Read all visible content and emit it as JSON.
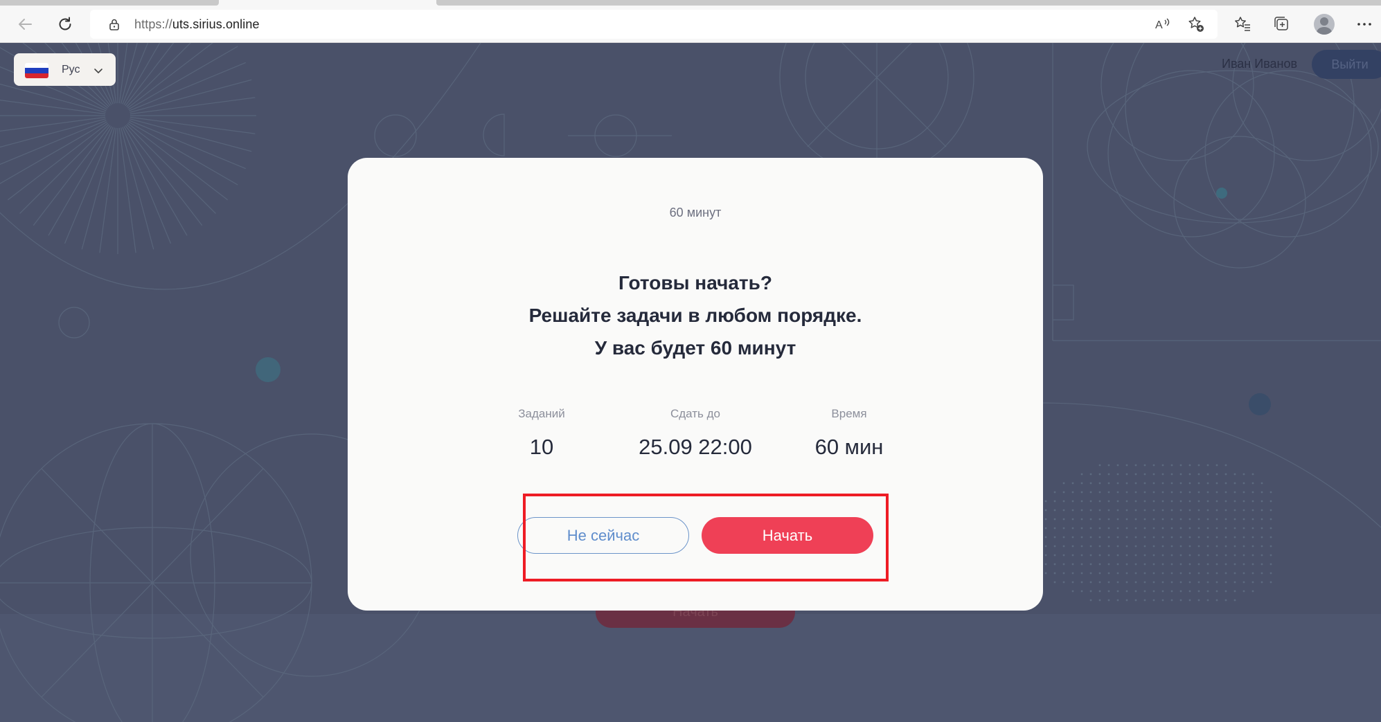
{
  "browser": {
    "url_scheme": "https://",
    "url_host": "uts.sirius.online",
    "icons": [
      "back-arrow-icon",
      "refresh-icon",
      "lock-icon",
      "read-aloud-icon",
      "add-favorite-icon",
      "favorites-icon",
      "collections-icon",
      "profile-avatar",
      "more-icon"
    ]
  },
  "page": {
    "language": {
      "label": "Рус",
      "flag_colors": [
        "#ffffff",
        "#1f3fbf",
        "#d7262f"
      ]
    },
    "user_name": "Иван Иванов",
    "logout_label": "Выйти",
    "background_start_label": "Начать"
  },
  "modal": {
    "duration": "60 минут",
    "headline": [
      "Готовы начать?",
      "Решайте задачи в любом порядке.",
      "У вас будет 60 минут"
    ],
    "stats": [
      {
        "label": "Заданий",
        "value": "10"
      },
      {
        "label": "Сдать до",
        "value": "25.09 22:00"
      },
      {
        "label": "Время",
        "value": "60 мин"
      }
    ],
    "later_label": "Не сейчас",
    "start_label": "Начать"
  },
  "colors": {
    "backdrop": "#4a5169",
    "modal_bg": "#fafaf9",
    "primary_button": "#ef4056",
    "secondary_button": "#5f8dcc",
    "highlight_frame": "#ee1c25"
  }
}
